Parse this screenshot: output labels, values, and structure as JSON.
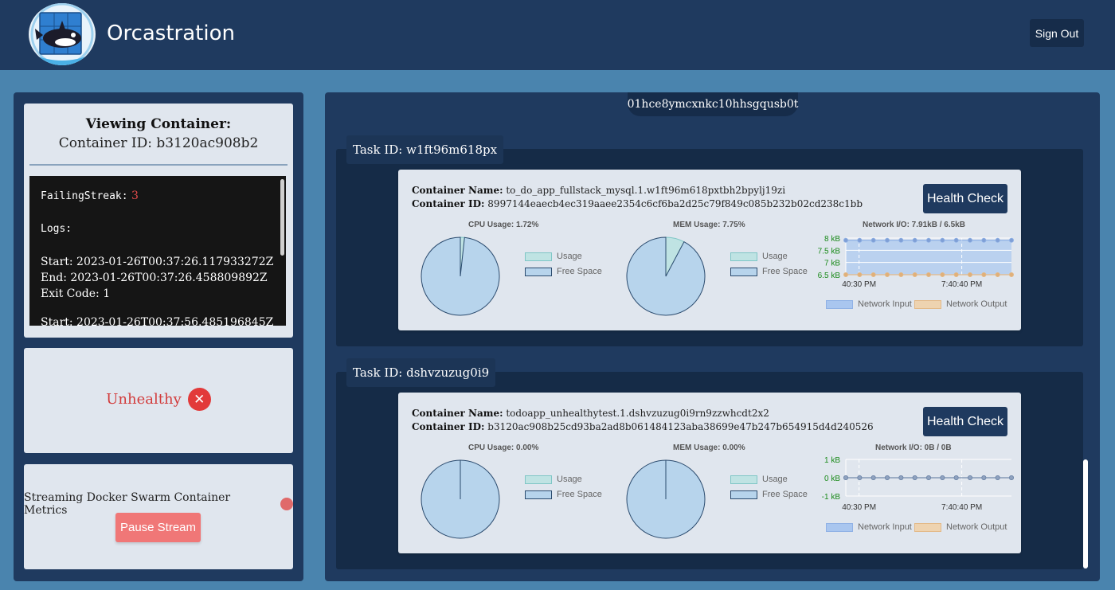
{
  "header": {
    "title": "Orcastration",
    "sign_out_label": "Sign Out"
  },
  "left": {
    "viewing_title": "Viewing Container:",
    "container_id_label": "Container ID: b3120ac908b2",
    "logs": {
      "failing_streak_label": "FailingStreak:",
      "failing_streak_value": "3",
      "logs_label": "Logs:",
      "start": "Start: 2023-01-26T00:37:26.117933272Z",
      "end": "End: 2023-01-26T00:37:26.458809892Z",
      "exit_code": "Exit Code: 1",
      "next_start": "Start: 2023-01-26T00:37:56.485196845Z"
    },
    "status_text": "Unhealthy",
    "status_icon": "x-circle-icon",
    "stream_label": "Streaming Docker Swarm Container Metrics",
    "pause_label": "Pause Stream"
  },
  "node_id": "01hce8ymcxnkc10hhsgqusb0t",
  "tasks": [
    {
      "task_label": "Task ID: w1ft96m618px",
      "container_name_label": "Container Name:",
      "container_name": "to_do_app_fullstack_mysql.1.w1ft96m618pxtbh2bpylj19zi",
      "container_id_label": "Container ID:",
      "container_id": "8997144eaecb4ec319aaee2354c6cf6ba2d25c79f849c085b232b02cd238c1bb",
      "health_check_label": "Health Check",
      "cpu_title": "CPU Usage: 1.72%",
      "mem_title": "MEM Usage: 7.75%",
      "net_title": "Network I/O: 7.91kB / 6.5kB",
      "legend_usage": "Usage",
      "legend_free": "Free Space",
      "legend_net_in": "Network Input",
      "legend_net_out": "Network Output",
      "y_ticks": [
        "8 kB",
        "7.5 kB",
        "7 kB",
        "6.5 kB"
      ],
      "x_ticks": [
        "40:30 PM",
        "7:40:40 PM"
      ]
    },
    {
      "task_label": "Task ID: dshvzuzug0i9",
      "container_name_label": "Container Name:",
      "container_name": "todoapp_unhealthytest.1.dshvzuzug0i9rn9zzwhcdt2x2",
      "container_id_label": "Container ID:",
      "container_id": "b3120ac908b25cd93ba2ad8b061484123aba38699e47b247b654915d4d240526",
      "health_check_label": "Health Check",
      "cpu_title": "CPU Usage: 0.00%",
      "mem_title": "MEM Usage: 0.00%",
      "net_title": "Network I/O: 0B / 0B",
      "legend_usage": "Usage",
      "legend_free": "Free Space",
      "legend_net_in": "Network Input",
      "legend_net_out": "Network Output",
      "y_ticks": [
        "1 kB",
        "0 kB",
        "-1 kB"
      ],
      "x_ticks": [
        "40:30 PM",
        "7:40:40 PM"
      ]
    }
  ],
  "colors": {
    "header_bg": "#1f3a5f",
    "page_bg": "#4a84ae",
    "unhealthy": "#d23b3b",
    "pause_button": "#f07777",
    "pie_free": "#b7d4ec",
    "pie_usage": "#bfe3e3",
    "net_input": "#a9c6ef",
    "net_output": "#eed3b0"
  },
  "chart_data": [
    {
      "type": "pie",
      "title": "CPU Usage: 1.72%",
      "labels": [
        "Usage",
        "Free Space"
      ],
      "values": [
        1.72,
        98.28
      ]
    },
    {
      "type": "pie",
      "title": "MEM Usage: 7.75%",
      "labels": [
        "Usage",
        "Free Space"
      ],
      "values": [
        7.75,
        92.25
      ]
    },
    {
      "type": "line",
      "title": "Network I/O: 7.91kB / 6.5kB",
      "x_tick_labels": [
        "40:30 PM",
        "7:40:40 PM"
      ],
      "y_tick_labels": [
        "8 kB",
        "7.5 kB",
        "7 kB",
        "6.5 kB"
      ],
      "ylim": [
        6.5,
        8
      ],
      "y_unit": "kB",
      "series": [
        {
          "name": "Network Input",
          "values": [
            7.91,
            7.91,
            7.91,
            7.91,
            7.91,
            7.91,
            7.91,
            7.91,
            7.91,
            7.91,
            7.91,
            7.91,
            7.91
          ]
        },
        {
          "name": "Network Output",
          "values": [
            6.5,
            6.5,
            6.5,
            6.5,
            6.5,
            6.5,
            6.5,
            6.5,
            6.5,
            6.5,
            6.5,
            6.5,
            6.5
          ]
        }
      ],
      "legend": "bottom"
    },
    {
      "type": "pie",
      "title": "CPU Usage: 0.00%",
      "labels": [
        "Usage",
        "Free Space"
      ],
      "values": [
        0,
        100
      ]
    },
    {
      "type": "pie",
      "title": "MEM Usage: 0.00%",
      "labels": [
        "Usage",
        "Free Space"
      ],
      "values": [
        0,
        100
      ]
    },
    {
      "type": "line",
      "title": "Network I/O: 0B / 0B",
      "x_tick_labels": [
        "40:30 PM",
        "7:40:40 PM"
      ],
      "y_tick_labels": [
        "1 kB",
        "0 kB",
        "-1 kB"
      ],
      "ylim": [
        -1,
        1
      ],
      "y_unit": "kB",
      "series": [
        {
          "name": "Network Input",
          "values": [
            0,
            0,
            0,
            0,
            0,
            0,
            0,
            0,
            0,
            0,
            0,
            0,
            0
          ]
        },
        {
          "name": "Network Output",
          "values": [
            0,
            0,
            0,
            0,
            0,
            0,
            0,
            0,
            0,
            0,
            0,
            0,
            0
          ]
        }
      ],
      "legend": "bottom"
    }
  ]
}
